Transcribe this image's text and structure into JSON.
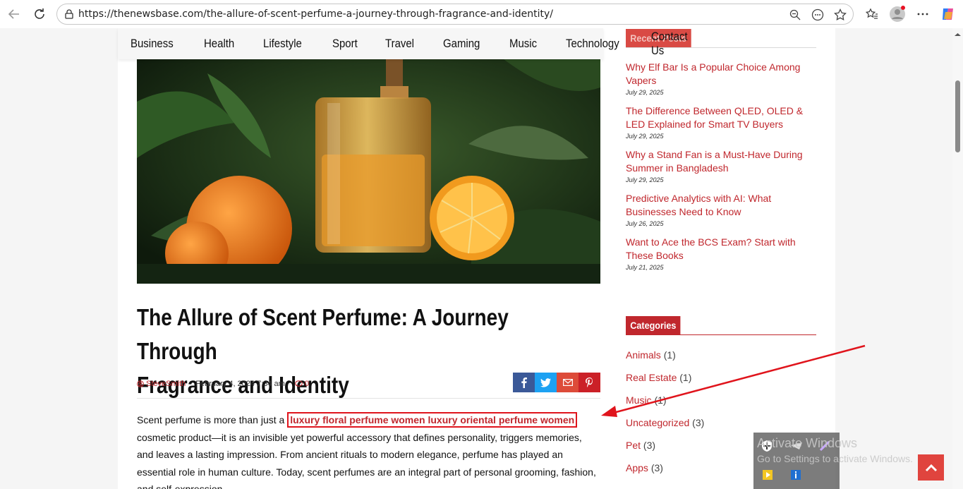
{
  "browser": {
    "url": "https://thenewsbase.com/the-allure-of-scent-perfume-a-journey-through-fragrance-and-identity/"
  },
  "nav": [
    "Business",
    "Health",
    "Lifestyle",
    "Sport",
    "Travel",
    "Gaming",
    "Music",
    "Technology",
    "Contact Us"
  ],
  "article": {
    "title_line1": "The Allure of Scent Perfume: A Journey Through",
    "title_line2": "Fragrance and Identity",
    "author": "SteveSmith",
    "date": "February 4, 2024 7:34 am",
    "comments": "0",
    "body_before": "Scent perfume is more than just a ",
    "body_link": "luxury floral perfume women luxury oriental perfume women",
    "body_after": " cosmetic product—it is an invisible yet powerful accessory that defines personality, triggers memories, and leaves a lasting impression. From ancient rituals to modern elegance, perfume has played an essential role in human culture. Today, scent perfumes are an integral part of personal grooming, fashion, and self-expression."
  },
  "share": {
    "facebook": "f",
    "twitter": "t",
    "email": "✉",
    "pinterest": "p",
    "colors": {
      "facebook": "#3b5998",
      "twitter": "#1da1f2",
      "email": "#dd4b39",
      "pinterest": "#cb2027"
    }
  },
  "sidebar": {
    "recent_title": "Recent Posts",
    "posts": [
      {
        "title": "Why Elf Bar Is a Popular Choice Among Vapers",
        "date": "July 29, 2025"
      },
      {
        "title": "The Difference Between QLED, OLED & LED Explained for Smart TV Buyers",
        "date": "July 29, 2025"
      },
      {
        "title": "Why a Stand Fan is a Must-Have During Summer in Bangladesh",
        "date": "July 29, 2025"
      },
      {
        "title": "Predictive Analytics with AI: What Businesses Need to Know",
        "date": "July 26, 2025"
      },
      {
        "title": "Want to Ace the BCS Exam? Start with These Books",
        "date": "July 21, 2025"
      }
    ],
    "categories_title": "Categories",
    "categories": [
      {
        "name": "Animals",
        "count": "(1)"
      },
      {
        "name": "Real Estate",
        "count": "(1)"
      },
      {
        "name": "Music",
        "count": "(1)"
      },
      {
        "name": "Uncategorized",
        "count": "(3)"
      },
      {
        "name": "Pet",
        "count": "(3)"
      },
      {
        "name": "Apps",
        "count": "(3)"
      }
    ]
  },
  "overlay": {
    "activate_title": "Activate Windows",
    "activate_sub": "Go to Settings to activate Windows."
  },
  "accent_color": "#c0272d"
}
